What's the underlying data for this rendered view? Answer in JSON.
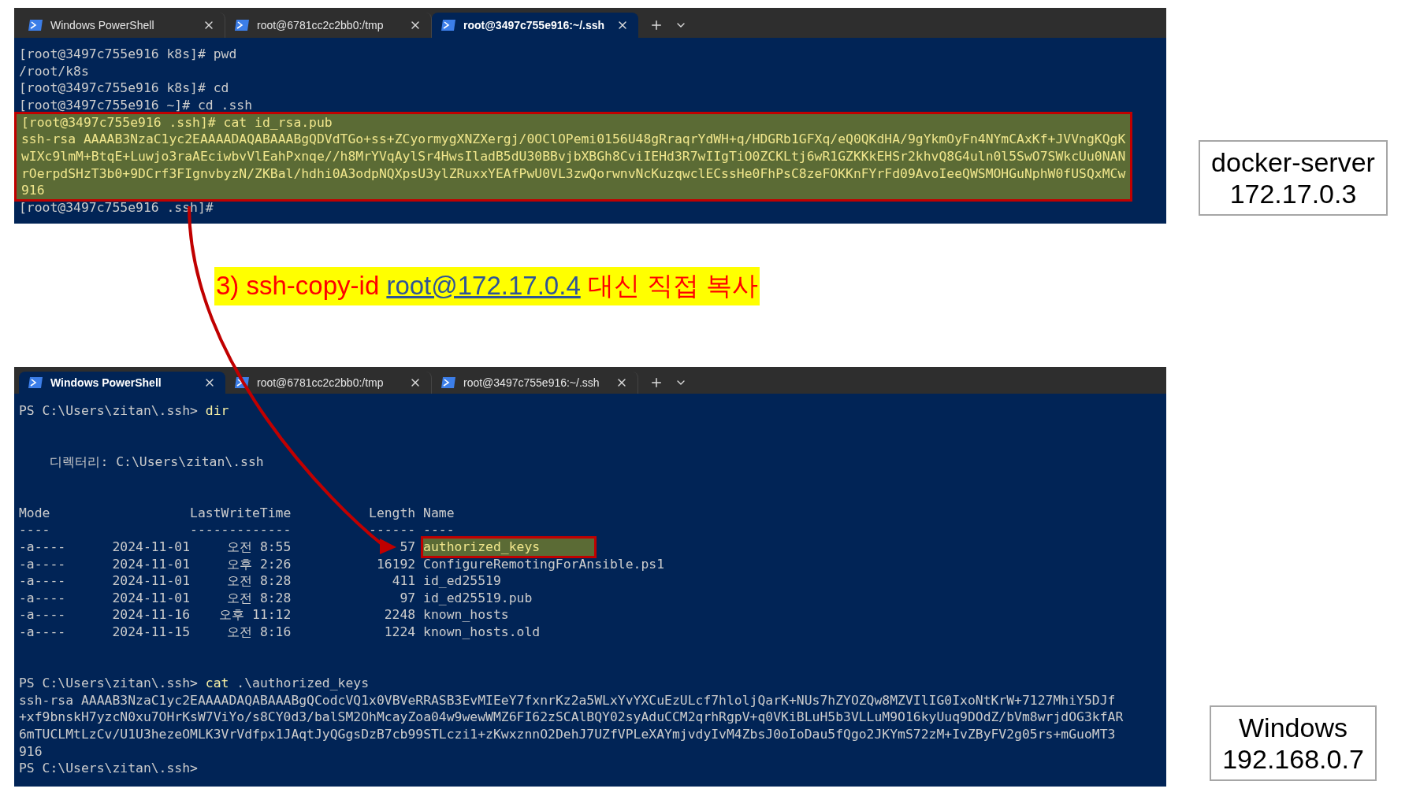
{
  "top_terminal": {
    "tabs": [
      {
        "label": "Windows PowerShell",
        "selected": false
      },
      {
        "label": "root@6781cc2c2bb0:/tmp",
        "selected": false
      },
      {
        "label": "root@3497c755e916:~/.ssh",
        "selected": true
      }
    ],
    "lines": [
      {
        "text": "[root@3497c755e916 k8s]# pwd",
        "highlighted": false
      },
      {
        "text": "/root/k8s",
        "highlighted": false
      },
      {
        "text": "[root@3497c755e916 k8s]# cd",
        "highlighted": false
      },
      {
        "text": "[root@3497c755e916 ~]# cd .ssh",
        "highlighted": false
      },
      {
        "text": "[root@3497c755e916 .ssh]# cat id_rsa.pub",
        "highlighted": true
      },
      {
        "text": "ssh-rsa AAAAB3NzaC1yc2EAAAADAQABAAABgQDVdTGo+ss+ZCyormygXNZXergj/0OClOPemi0156U48gRraqrYdWH+q/HDGRb1GFXq/eQ0QKdHA/9gYkmOyFn4NYmCAxKf+JVVngKQgK",
        "highlighted": true
      },
      {
        "text": "wIXc9lmM+BtqE+Luwjo3raAEciwbvVlEahPxnqe//h8MrYVqAylSr4HwsIladB5dU30BBvjbXBGh8CviIEHd3R7wIIgTiO0ZCKLtj6wR1GZKKkEHSr2khvQ8G4uln0l5SwO7SWkcUu0NAN",
        "highlighted": true
      },
      {
        "text": "rOerpdSHzT3b0+9DCrf3FIgnvbyzN/ZKBal/hdhi0A3odpNQXpsU3ylZRuxxYEAfPwU0VL3zwQorwnvNcKuzqwclECssHe0FhPsC8zeFOKKnFYrFd09AvoIeeQWSMOHGuNphW0fUSQxMCw",
        "highlighted": true
      },
      {
        "text": "916",
        "highlighted": true
      },
      {
        "text": "[root@3497c755e916 .ssh]#",
        "highlighted": false
      }
    ]
  },
  "caption": {
    "before": "3) ssh-copy-id ",
    "link": "root@172.17.0.4",
    "after": " 대신 직접 복사"
  },
  "bottom_terminal": {
    "tabs": [
      {
        "label": "Windows PowerShell",
        "selected": true
      },
      {
        "label": "root@6781cc2c2bb0:/tmp",
        "selected": false
      },
      {
        "label": "root@3497c755e916:~/.ssh",
        "selected": false
      }
    ],
    "lines": [
      {
        "kind": "prompt",
        "prompt": "PS C:\\Users\\zitan\\.ssh>",
        "command": "dir"
      },
      {
        "kind": "directory",
        "text": "디렉터리: C:\\Users\\zitan\\.ssh"
      },
      {
        "kind": "listing",
        "columns": [
          "Mode",
          "LastWriteTime",
          "Length",
          "Name"
        ],
        "rule": [
          "----",
          "-------------",
          "------",
          "----"
        ],
        "rows": [
          {
            "mode": "-a----",
            "date": "2024-11-01",
            "time": "오전 8:55",
            "length": "57",
            "name": "authorized_keys",
            "highlighted": true
          },
          {
            "mode": "-a----",
            "date": "2024-11-01",
            "time": "오후 2:26",
            "length": "16192",
            "name": "ConfigureRemotingForAnsible.ps1",
            "highlighted": false
          },
          {
            "mode": "-a----",
            "date": "2024-11-01",
            "time": "오전 8:28",
            "length": "411",
            "name": "id_ed25519",
            "highlighted": false
          },
          {
            "mode": "-a----",
            "date": "2024-11-01",
            "time": "오전 8:28",
            "length": "97",
            "name": "id_ed25519.pub",
            "highlighted": false
          },
          {
            "mode": "-a----",
            "date": "2024-11-16",
            "time": "오후 11:12",
            "length": "2248",
            "name": "known_hosts",
            "highlighted": false
          },
          {
            "mode": "-a----",
            "date": "2024-11-15",
            "time": "오전 8:16",
            "length": "1224",
            "name": "known_hosts.old",
            "highlighted": false
          }
        ]
      },
      {
        "kind": "prompt",
        "prompt": "PS C:\\Users\\zitan\\.ssh>",
        "command": "cat",
        "args": " .\\authorized_keys"
      },
      {
        "kind": "output",
        "text": "ssh-rsa AAAAB3NzaC1yc2EAAAADAQABAAABgQCodcVQ1x0VBVeRRASB3EvMIEeY7fxnrKz2a5WLxYvYXCuEzULcf7hloljQarK+NUs7hZYOZQw8MZVIlIG0IxoNtKrW+7127MhiY5DJf"
      },
      {
        "kind": "output",
        "text": "+xf9bnskH7yzcN0xu7OHrKsW7ViYo/s8CY0d3/balSM2OhMcayZoa04w9wewWMZ6FI62zSCAlBQY02syAduCCM2qrhRgpV+q0VKiBLuH5b3VLLuM9O16kyUuq9DOdZ/bVm8wrjdOG3kfAR"
      },
      {
        "kind": "output",
        "text": "6mTUCLMtLzCv/U1U3hezeOMLK3VrVdfpx1JAqtJyQGgsDzB7cb99STLczi1+zKwxznnO2DehJ7UZfVPLeXAYmjvdyIvM4ZbsJ0oIoDau5fQgo2JKYmS72zM+IvZByFV2g05rs+mGuoMT3"
      },
      {
        "kind": "output",
        "text": "916"
      },
      {
        "kind": "prompt",
        "prompt": "PS C:\\Users\\zitan\\.ssh>"
      }
    ]
  },
  "labels": [
    {
      "name": "docker-server",
      "address": "172.17.0.3"
    },
    {
      "name": "Windows",
      "address": "192.168.0.7"
    }
  ]
}
